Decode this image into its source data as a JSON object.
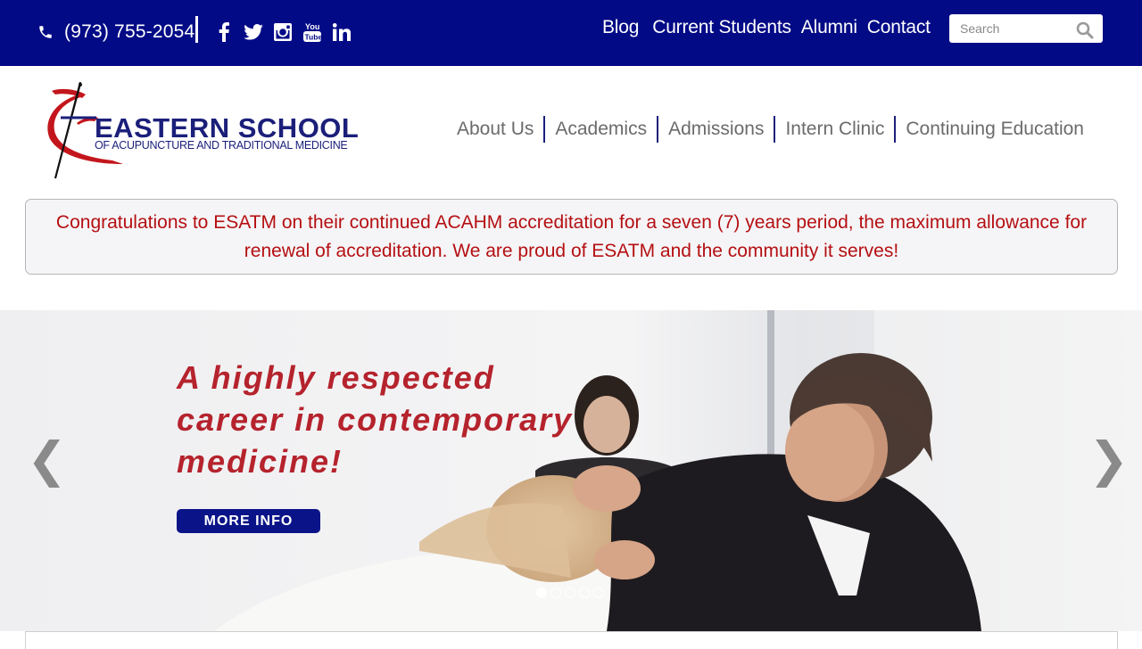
{
  "topbar": {
    "phone": "(973) 755-2054",
    "social": [
      "facebook-icon",
      "twitter-icon",
      "instagram-icon",
      "youtube-icon",
      "linkedin-icon"
    ],
    "links": [
      "Blog",
      "Current Students",
      "Alumni",
      "Contact"
    ],
    "search_placeholder": "Search",
    "background": "#020a86"
  },
  "logo": {
    "line1": "EASTERN SCHOOL",
    "line2": "OF ACUPUNCTURE AND TRADITIONAL MEDICINE"
  },
  "mainnav": [
    "About Us",
    "Academics",
    "Admissions",
    "Intern Clinic",
    "Continuing Education"
  ],
  "notice": {
    "text": "Congratulations to ESATM on their continued ACAHM accreditation for a seven (7) years period, the maximum allowance for renewal of accreditation. We are proud of ESATM and the community it serves!",
    "color": "#b50f12"
  },
  "slider": {
    "headline_line1": "A highly respected",
    "headline_line2": "career in contemporary",
    "headline_line3": "medicine!",
    "button": "MORE INFO",
    "prev_arrow": "❮",
    "next_arrow": "❯",
    "slides_total": 5,
    "active_slide": 1
  }
}
